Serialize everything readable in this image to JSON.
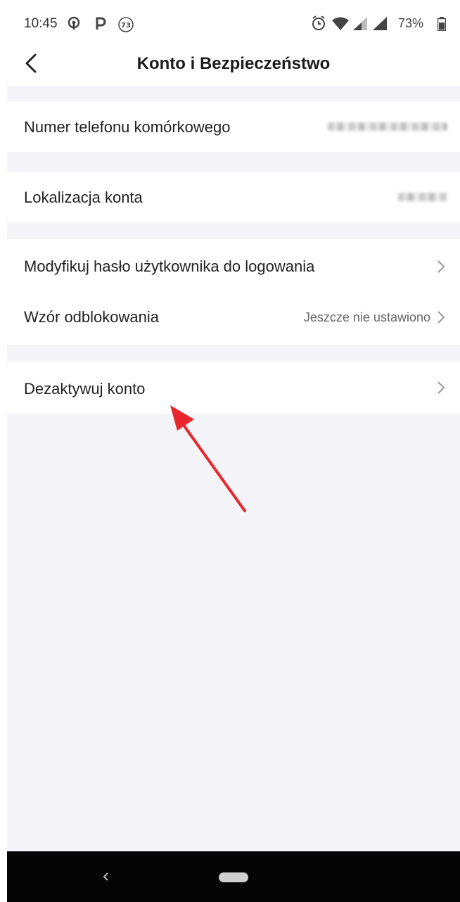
{
  "status_bar": {
    "time": "10:45",
    "notification_icons": [
      "podcast-icon",
      "parking-icon",
      "badge-73-icon"
    ],
    "badge_count": "73",
    "battery": "73%"
  },
  "header": {
    "title": "Konto i Bezpieczeństwo"
  },
  "rows": {
    "phone_label": "Numer telefonu komórkowego",
    "location_label": "Lokalizacja konta",
    "password_label": "Modyfikuj hasło użytkownika do logowania",
    "pattern_label": "Wzór odblokowania",
    "pattern_value": "Jeszcze nie ustawiono",
    "deactivate_label": "Dezaktywuj konto"
  },
  "colors": {
    "background": "#f5f4f8",
    "card": "#ffffff",
    "annotation_arrow": "#e8262b",
    "navbar": "#050505"
  }
}
